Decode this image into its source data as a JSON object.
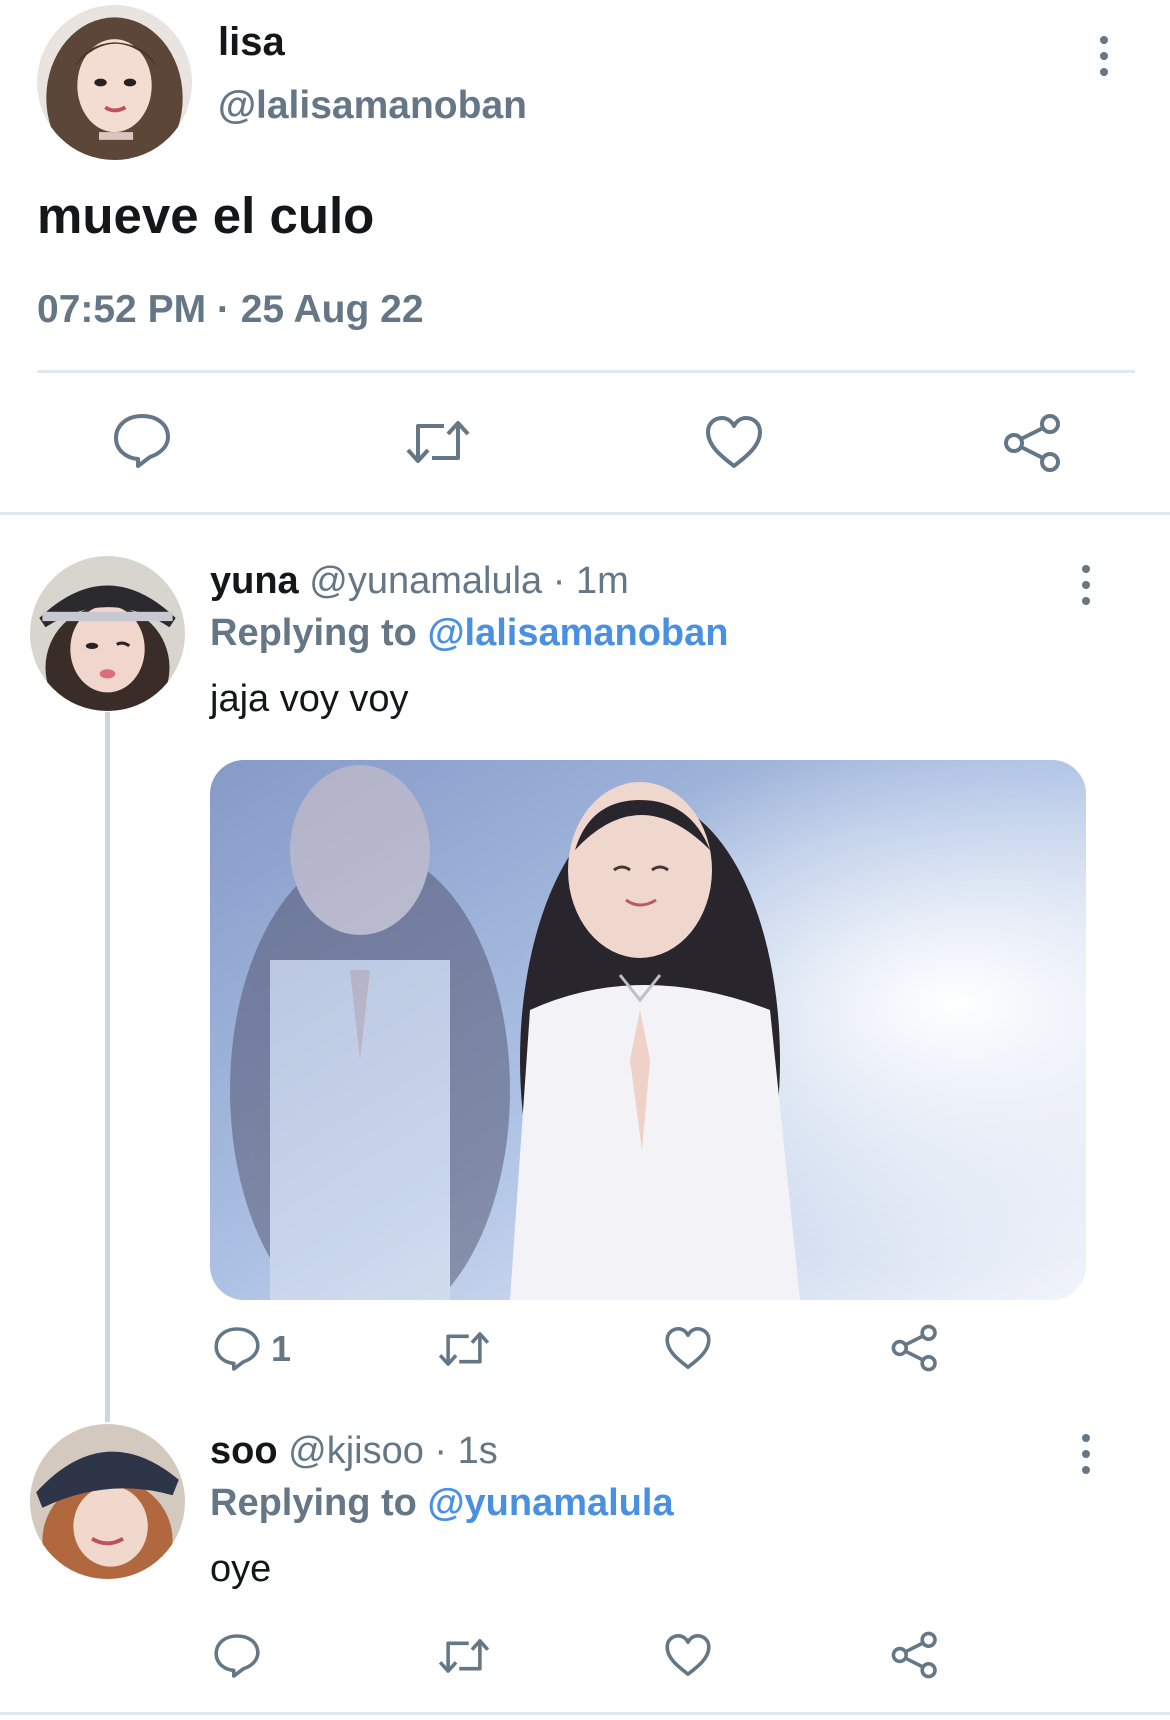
{
  "main_tweet": {
    "display_name": "lisa",
    "handle": "@lalisamanoban",
    "text": "mueve el culo",
    "timestamp": "07:52 PM · 25 Aug 22",
    "actions": [
      "reply-icon",
      "retweet-icon",
      "like-icon",
      "share-icon"
    ]
  },
  "replies": [
    {
      "display_name": "yuna",
      "handle": "@yunamalula",
      "time": "· 1m",
      "replying_prefix": "Replying to",
      "replying_handle": "@lalisamanoban",
      "text": "jaja voy voy",
      "has_media": true,
      "reply_count": "1"
    },
    {
      "display_name": "soo",
      "handle": "@kjisoo",
      "time": "· 1s",
      "replying_prefix": "Replying to",
      "replying_handle": "@yunamalula",
      "text": "oye",
      "has_media": false,
      "reply_count": ""
    }
  ],
  "colors": {
    "text": "#14171a",
    "muted": "#657786",
    "link": "#4a90e2",
    "divider": "#e1e8ed"
  }
}
